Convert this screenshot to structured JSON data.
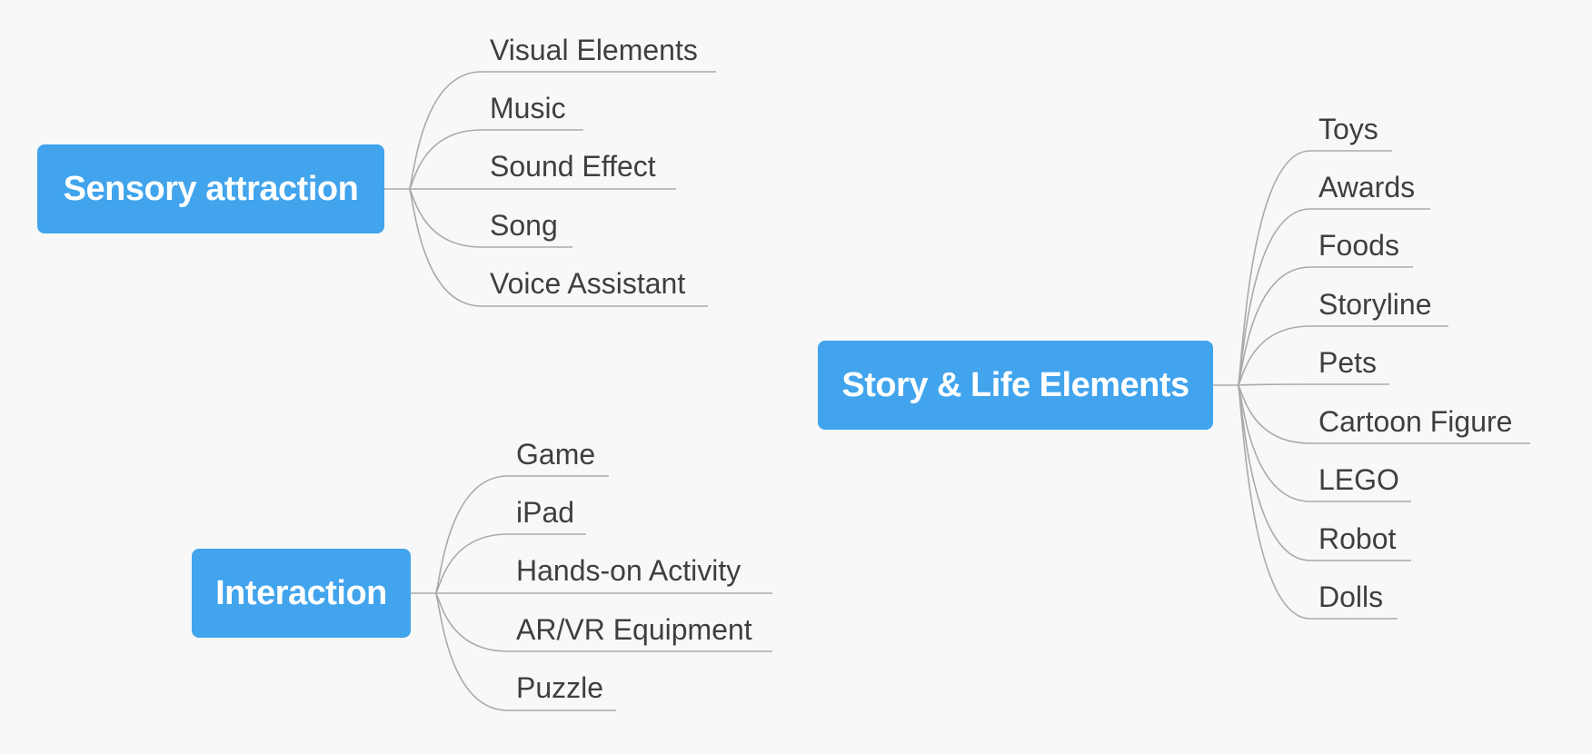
{
  "mindmap": {
    "line_color": "#aaaaaa",
    "topic_color": "#41a4ed",
    "branches": [
      {
        "title": "Sensory attraction",
        "items": [
          "Visual Elements",
          "Music",
          "Sound Effect",
          "Song",
          "Voice Assistant"
        ]
      },
      {
        "title": "Interaction",
        "items": [
          "Game",
          "iPad",
          "Hands-on Activity",
          "AR/VR Equipment",
          "Puzzle"
        ]
      },
      {
        "title": "Story & Life Elements",
        "items": [
          "Toys",
          "Awards",
          "Foods",
          "Storyline",
          "Pets",
          "Cartoon Figure",
          "LEGO",
          "Robot",
          "Dolls"
        ]
      }
    ]
  }
}
